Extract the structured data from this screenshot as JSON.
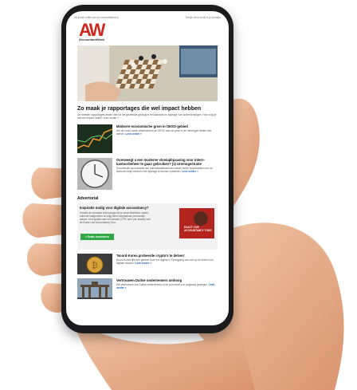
{
  "topbar": {
    "left": "Dit is een editie van AccountantWeek.nl",
    "right": "Bekijk deze email in je browser"
  },
  "logo": {
    "letters": "AW",
    "sub": "AccountantWeek"
  },
  "hero_icon": "chessboard-photo",
  "headline": "Zo maak je rapportages die wel impact hebben",
  "intro": "De meeste rapportages leiden niet tot het gewenste gedrag in het aandeel en bijdrage van ondernemingen. Hoe zorg je dat wel impact heeft? Lees verder »",
  "articles": [
    {
      "title": "Minkerre economische groei in OESO-gebied",
      "body": "Het de zoom mede ondernemers de OESO was de groei in de Verenigde Staten iets sterker.",
      "more": "Lees verder »",
      "icon": "stock-chart-photo"
    },
    {
      "title": "Overweegt u een moderne vloeiupbpaaving voor intern-kantoorbeheer te gaan gebruiken? (1) Uremogestratie",
      "body": "Succesvolle accountants van administratiekantoren weten welke hulpmiddelen kun ze kantoren helpt beheren een bijdrage te kunnen presteren.",
      "more": "Lees verder »",
      "icon": "clock-photo"
    }
  ],
  "advert": {
    "label": "Advertorial",
    "title": "Inspiratie nodig voor digitale accountancy?",
    "body": "Ontdek de nieuwste technologie die je werk efficiënter maakt, ontmoet vakgenoten en krijg direct toepasbaar persoonlijk advies. Kom gratis naar het nieuwe (2 PE-uren per sessie) van de Exact Live Accountancy Tour.",
    "button": "» Gratis inschrijven",
    "image_text": "EXACT LIVE ACCOUNTANCY TOUR",
    "image_icon": "speaker-photo"
  },
  "news": [
    {
      "title": "'Noord-Korea probeerde crypto's te delven'",
      "body": "Noord-Korea lijkt een geheim door het regime in Pyongyang ook met op de markt voor digitale munten.",
      "more": "Lees verder »",
      "icon": "crypto-coin-photo"
    },
    {
      "title": "Vertrouwen Duitse ondernemers omhoog",
      "body": "Het vertrouwen van Duitse ondernemers in de economie is in augustus gestegen.",
      "more": "Lees verder »",
      "icon": "brandenburg-gate-photo"
    }
  ]
}
